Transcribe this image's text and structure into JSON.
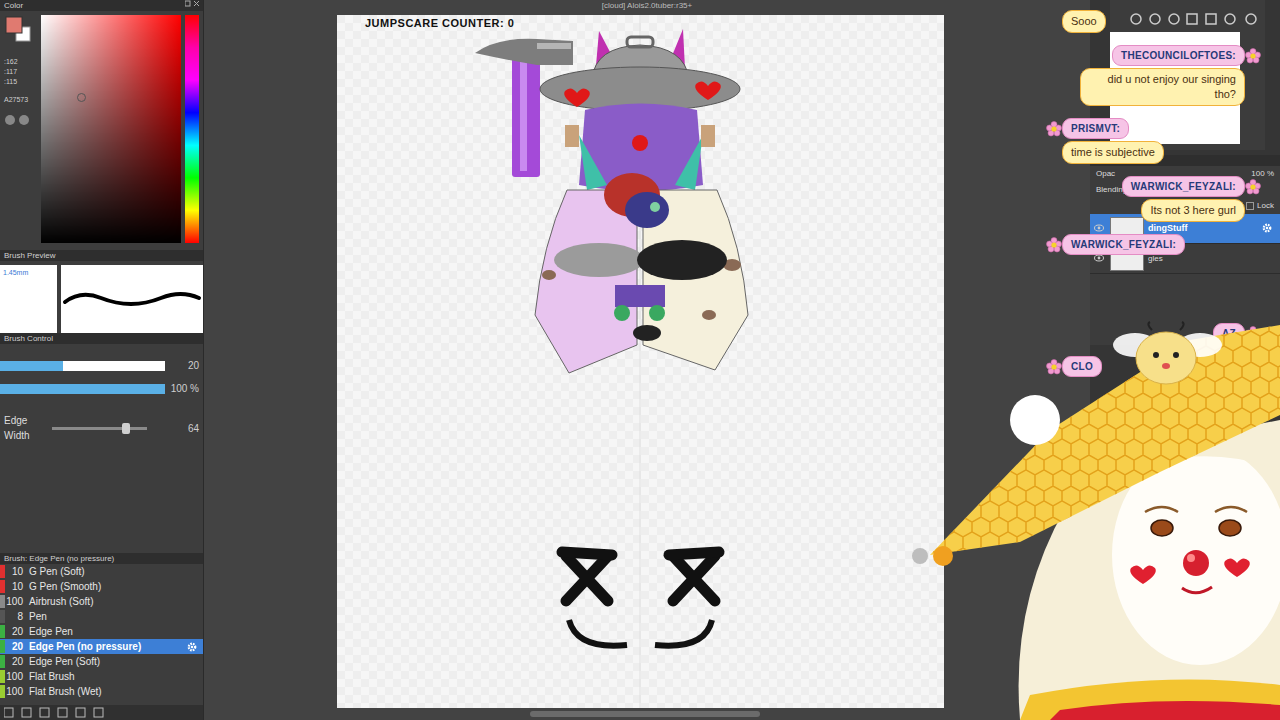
{
  "window": {
    "title": "[cloud] Alois2.0tuber:r35+"
  },
  "color_panel": {
    "title": "Color",
    "values": [
      ":162",
      ":117",
      ":115"
    ],
    "hex": "A27573"
  },
  "brush_preview": {
    "title": "Brush Preview",
    "size": "1.45mm"
  },
  "brush_control": {
    "title": "Brush Control",
    "sliders": [
      {
        "kind": "bar",
        "reading": "20",
        "level": 0.38
      },
      {
        "kind": "bar",
        "reading": "100 %",
        "level": 1
      },
      {
        "kind": "knob",
        "label": "Edge Width",
        "reading": "64",
        "level": 0.78
      }
    ]
  },
  "brush_list": {
    "title": "Brush: Edge Pen (no pressure)",
    "items": [
      {
        "size": "10",
        "name": "G Pen (Soft)",
        "selected": false,
        "color": "#e03030"
      },
      {
        "size": "10",
        "name": "G Pen (Smooth)",
        "selected": false,
        "color": "#e03030"
      },
      {
        "size": "100",
        "name": "Airbrush (Soft)",
        "selected": false,
        "color": "#8a8a8a"
      },
      {
        "size": "8",
        "name": "Pen",
        "selected": false,
        "color": "#555555"
      },
      {
        "size": "20",
        "name": "Edge Pen",
        "selected": false,
        "color": "#3cb043"
      },
      {
        "size": "20",
        "name": "Edge Pen (no pressure)",
        "selected": true,
        "color": "#3cb043"
      },
      {
        "size": "20",
        "name": "Edge Pen (Soft)",
        "selected": false,
        "color": "#3cb043"
      },
      {
        "size": "100",
        "name": "Flat Brush",
        "selected": false,
        "color": "#9acd32"
      },
      {
        "size": "100",
        "name": "Flat Brush (Wet)",
        "selected": false,
        "color": "#9acd32"
      }
    ]
  },
  "canvas": {
    "caption": "JUMPSCARE COUNTER: 0"
  },
  "layer_panel": {
    "opacity_label": "Opac",
    "opacity": "100 %",
    "blending_label": "Blending",
    "lock_label": "Lock",
    "layers": [
      {
        "name": "dingStuff",
        "selected": true
      },
      {
        "name": "gles",
        "selected": false
      }
    ]
  },
  "chat": {
    "messages": [
      {
        "text": "Sooo"
      },
      {
        "user": "THECOUNCILOFTOES:",
        "text": "did u not enjoy our singing tho?"
      },
      {
        "user": "PRISMVT:",
        "text": "time is subjective"
      },
      {
        "user": "WARWICK_FEYZALI:",
        "text": "Its not 3 here gurl"
      },
      {
        "user": "WARWICK_FEYZALI:"
      },
      {
        "user": "AZ"
      },
      {
        "user": "CLO"
      }
    ]
  }
}
